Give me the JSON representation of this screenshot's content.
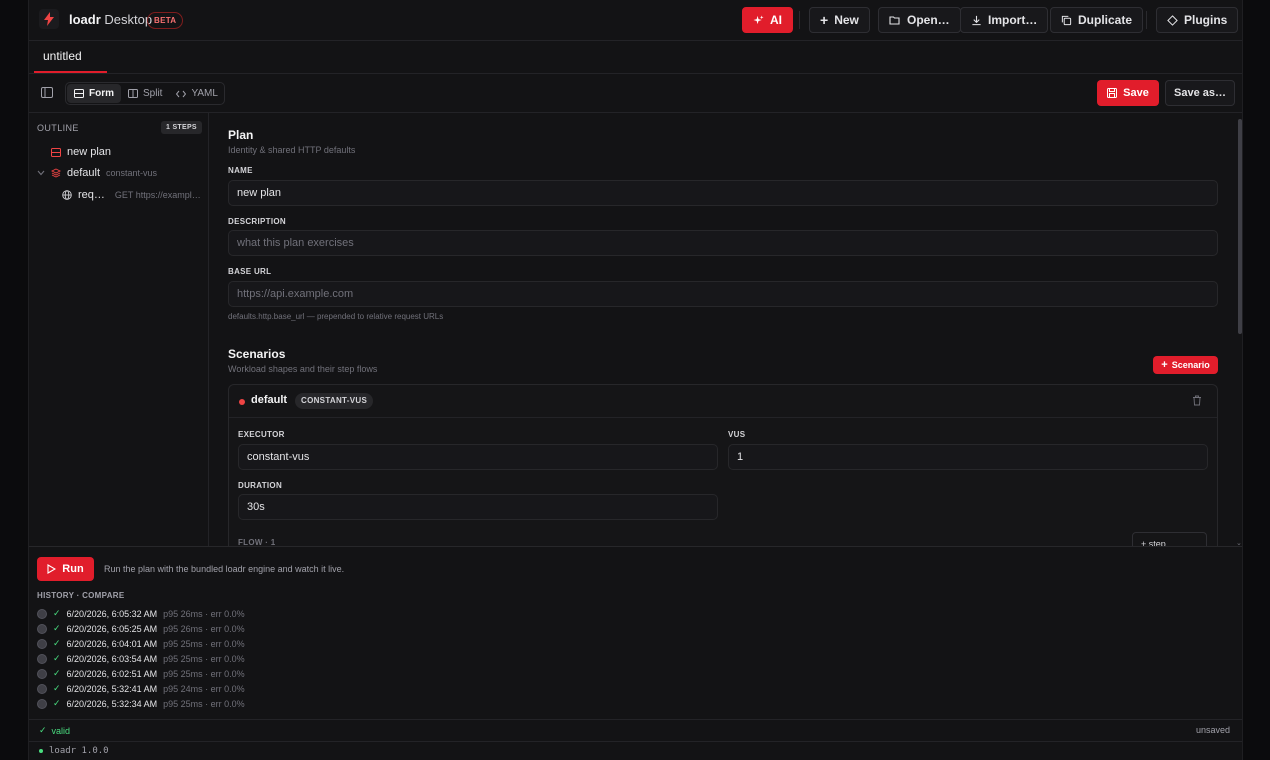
{
  "header": {
    "app_name_bold": "loadr",
    "app_name_light": "Desktop",
    "beta_label": "BETA",
    "buttons": {
      "ai": "AI",
      "new": "New",
      "open": "Open…",
      "import": "Import…",
      "duplicate": "Duplicate",
      "plugins": "Plugins"
    }
  },
  "tabs": [
    {
      "label": "untitled"
    }
  ],
  "toolbar": {
    "modes": [
      {
        "label": "Form"
      },
      {
        "label": "Split"
      },
      {
        "label": "YAML"
      }
    ],
    "save_label": "Save",
    "save_as_label": "Save as…"
  },
  "outline": {
    "header": "OUTLINE",
    "steps_badge": "1 STEPS",
    "items": [
      {
        "label": "new plan",
        "sub": ""
      },
      {
        "label": "default",
        "sub": "constant-vus"
      },
      {
        "label": "req…",
        "sub": "GET https://exampl…"
      }
    ]
  },
  "plan": {
    "title": "Plan",
    "subtitle": "Identity & shared HTTP defaults",
    "name_label": "NAME",
    "name_value": "new plan",
    "description_label": "DESCRIPTION",
    "description_placeholder": "what this plan exercises",
    "base_url_label": "BASE URL",
    "base_url_placeholder": "https://api.example.com",
    "base_url_hint": "defaults.http.base_url — prepended to relative request URLs"
  },
  "scenarios": {
    "title": "Scenarios",
    "subtitle": "Workload shapes and their step flows",
    "add_label": "Scenario",
    "items": [
      {
        "name": "default",
        "badge": "CONSTANT-VUS",
        "executor_label": "EXECUTOR",
        "executor_value": "constant-vus",
        "vus_label": "VUS",
        "vus_value": "1",
        "duration_label": "DURATION",
        "duration_value": "30s",
        "flow_label": "FLOW · 1",
        "add_step_label": "+ step…"
      }
    ]
  },
  "run": {
    "button_label": "Run",
    "description": "Run the plan with the bundled loadr engine and watch it live."
  },
  "history": {
    "header": "HISTORY · COMPARE",
    "rows": [
      {
        "time": "6/20/2026, 6:05:32 AM",
        "stats": "p95 26ms · err 0.0%"
      },
      {
        "time": "6/20/2026, 6:05:25 AM",
        "stats": "p95 26ms · err 0.0%"
      },
      {
        "time": "6/20/2026, 6:04:01 AM",
        "stats": "p95 25ms · err 0.0%"
      },
      {
        "time": "6/20/2026, 6:03:54 AM",
        "stats": "p95 25ms · err 0.0%"
      },
      {
        "time": "6/20/2026, 6:02:51 AM",
        "stats": "p95 25ms · err 0.0%"
      },
      {
        "time": "6/20/2026, 5:32:41 AM",
        "stats": "p95 24ms · err 0.0%"
      },
      {
        "time": "6/20/2026, 5:32:34 AM",
        "stats": "p95 25ms · err 0.0%"
      }
    ]
  },
  "status": {
    "valid_label": "valid",
    "unsaved_label": "unsaved",
    "version": "loadr 1.0.0"
  },
  "colors": {
    "accent": "#e11d2b",
    "success": "#4ade80",
    "background": "#131315"
  },
  "icons": [
    "bolt-logo-icon",
    "sparkles-icon",
    "plus-icon",
    "folder-open-icon",
    "download-icon",
    "copy-icon",
    "plugin-icon",
    "sidebar-toggle-icon",
    "form-icon",
    "split-icon",
    "code-icon",
    "save-icon",
    "chevron-down-icon",
    "layers-icon",
    "globe-icon",
    "trash-icon",
    "play-icon",
    "check-icon"
  ]
}
